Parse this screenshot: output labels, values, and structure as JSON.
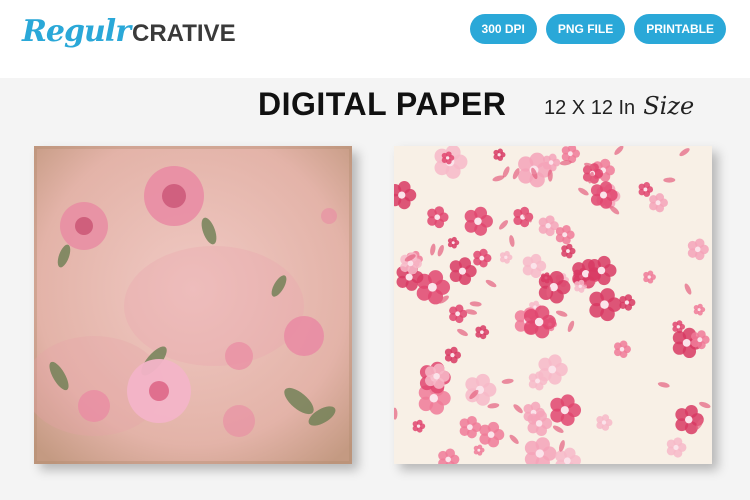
{
  "brand": {
    "script_part": "Regulr",
    "block_part": "CRATIVE",
    "colors": {
      "accent": "#2aa8d8",
      "dark": "#3a3a3a"
    }
  },
  "badges": [
    "300 DPI",
    "PNG FILE",
    "PRINTABLE"
  ],
  "headline": "DIGITAL PAPER",
  "size": {
    "main": "12 X 12 In",
    "script": "Size"
  },
  "papers": [
    {
      "style": "vintage-pink-floral",
      "background": "#e8bfb4"
    },
    {
      "style": "pink-floral-on-cream",
      "background": "#f8f0e6"
    }
  ]
}
